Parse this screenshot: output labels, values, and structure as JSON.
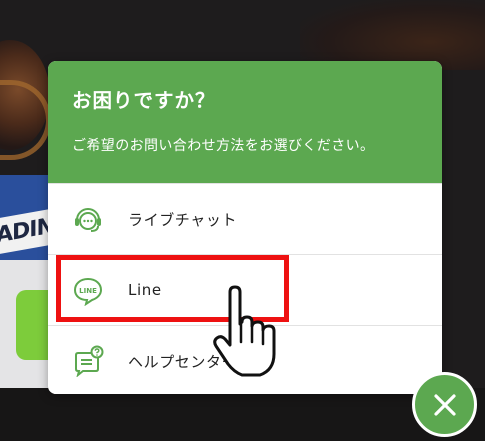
{
  "help_modal": {
    "title": "お困りですか？",
    "subtitle": "ご希望のお問い合わせ方法をお選びください。",
    "options": [
      {
        "label": "ライブチャット",
        "icon": "chat-headset-icon"
      },
      {
        "label": "Line",
        "icon": "line-icon",
        "icon_text": "LINE"
      },
      {
        "label": "ヘルプセンター",
        "icon": "help-center-icon"
      }
    ]
  },
  "background_sign_text": "ADIN",
  "close_button": {
    "icon": "close-icon"
  },
  "cursor": {
    "icon": "hand-pointer-icon"
  },
  "colors": {
    "brand_green": "#5ca850",
    "highlight_red": "#ee1111",
    "text": "#222222"
  }
}
